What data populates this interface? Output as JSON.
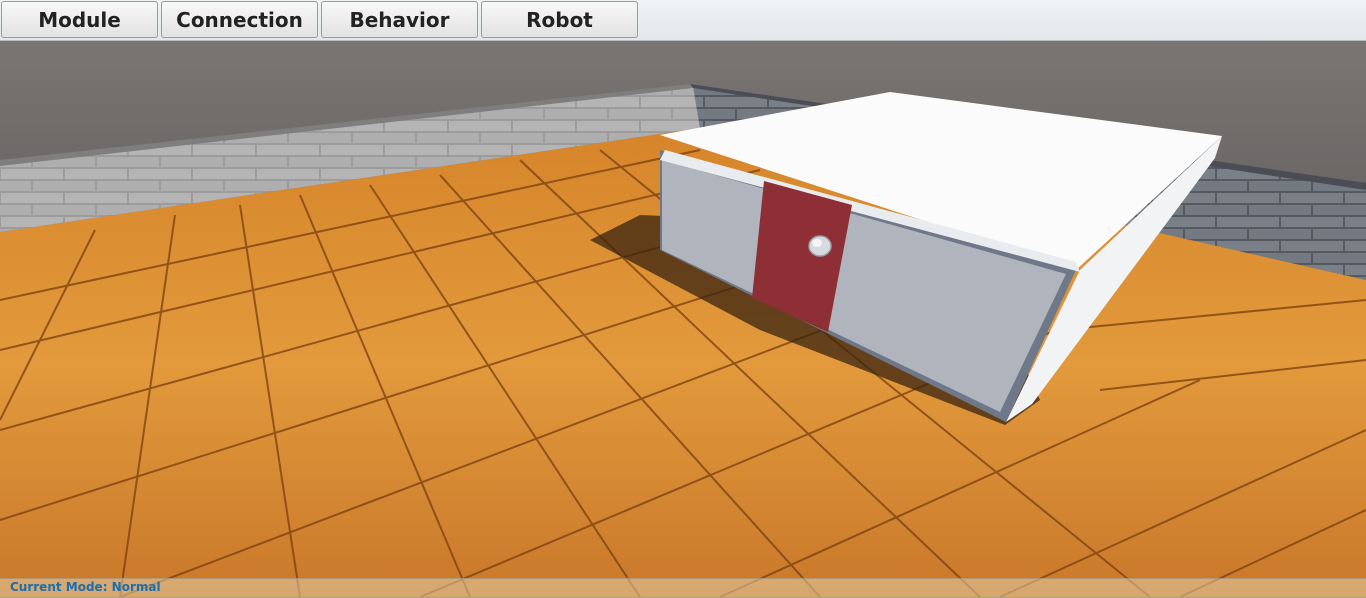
{
  "menu": {
    "module_label": "Module",
    "connection_label": "Connection",
    "behavior_label": "Behavior",
    "robot_label": "Robot"
  },
  "status": {
    "text": "Current Mode: Normal",
    "color": "#1a6fb0"
  },
  "scene": {
    "floor_color": "#d9882c",
    "wall_color": "#a7a7a7",
    "module_color": "#e9ecef",
    "connector_color": "#8e2f36"
  }
}
